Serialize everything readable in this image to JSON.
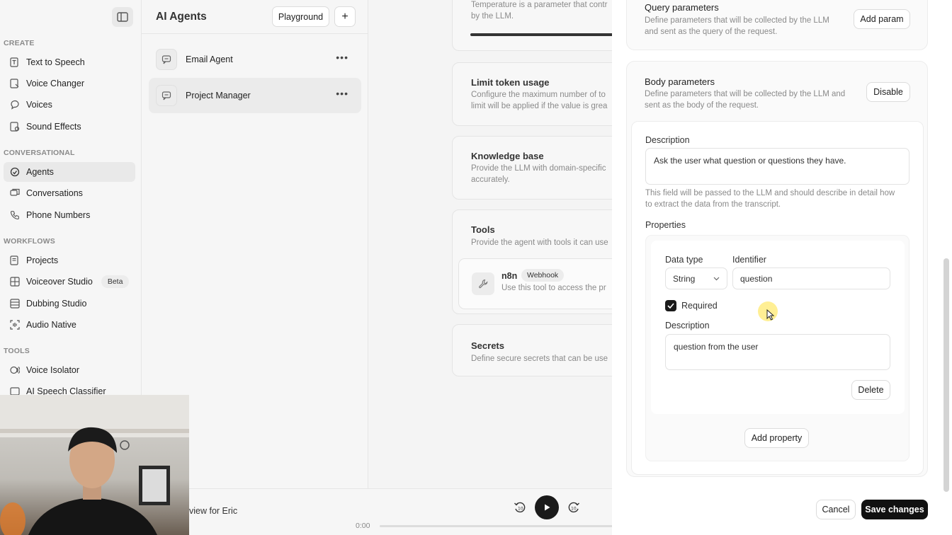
{
  "sidebar": {
    "sections": {
      "create": "CREATE",
      "conversational": "CONVERSATIONAL",
      "workflows": "WORKFLOWS",
      "tools": "TOOLS"
    },
    "items": {
      "text_to_speech": "Text to Speech",
      "voice_changer": "Voice Changer",
      "voices": "Voices",
      "sound_effects": "Sound Effects",
      "agents": "Agents",
      "conversations": "Conversations",
      "phone_numbers": "Phone Numbers",
      "projects": "Projects",
      "voiceover_studio": "Voiceover Studio",
      "voiceover_badge": "Beta",
      "dubbing_studio": "Dubbing Studio",
      "audio_native": "Audio Native",
      "voice_isolator": "Voice Isolator",
      "ai_speech_classifier": "AI Speech Classifier"
    }
  },
  "agents_panel": {
    "title": "AI Agents",
    "playground_label": "Playground",
    "add_label": "+",
    "agents": [
      "Email Agent",
      "Project Manager"
    ]
  },
  "config": {
    "temperature_desc": [
      "Temperature is a parameter that contr",
      "by the LLM."
    ],
    "limit_title": "Limit token usage",
    "limit_desc": [
      "Configure the maximum number of to",
      "limit will be applied if the value is grea"
    ],
    "kb_title": "Knowledge base",
    "kb_desc": [
      "Provide the LLM with domain-specific",
      "accurately."
    ],
    "tools_title": "Tools",
    "tools_desc": "Provide the agent with tools it can use",
    "tool_name": "n8n",
    "tool_badge": "Webhook",
    "tool_desc": "Use this tool to access the pr",
    "secrets_title": "Secrets",
    "secrets_desc": "Define secure secrets that can be use"
  },
  "player": {
    "caption": "view for Eric",
    "time": "0:00"
  },
  "drawer": {
    "query_title": "Query parameters",
    "query_desc": [
      "Define parameters that will be collected by the LLM",
      "and sent as the query of the request."
    ],
    "add_param_label": "Add param",
    "body_title": "Body parameters",
    "body_desc": [
      "Define parameters that will be collected by the LLM and",
      "sent as the body of the request."
    ],
    "disable_label": "Disable",
    "description_label": "Description",
    "description_value": "Ask the user what question or questions they have.",
    "description_help": [
      "This field will be passed to the LLM and should describe in detail how",
      "to extract the data from the transcript."
    ],
    "properties_label": "Properties",
    "data_type_label": "Data type",
    "data_type_value": "String",
    "identifier_label": "Identifier",
    "identifier_value": "question",
    "required_label": "Required",
    "prop_description_label": "Description",
    "prop_description_value": "question from the user",
    "delete_label": "Delete",
    "add_property_label": "Add property",
    "cancel_label": "Cancel",
    "save_label": "Save changes"
  }
}
